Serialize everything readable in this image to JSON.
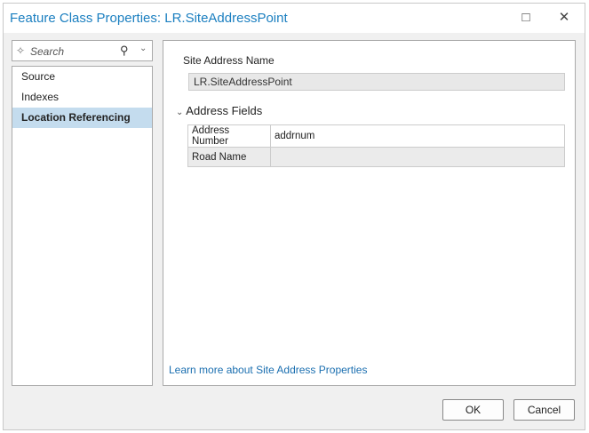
{
  "window": {
    "title": "Feature Class Properties: LR.SiteAddressPoint",
    "maximize_icon": "□",
    "close_icon": "✕"
  },
  "sidebar": {
    "search_placeholder": "Search",
    "items": [
      {
        "label": "Source"
      },
      {
        "label": "Indexes"
      },
      {
        "label": "Location Referencing",
        "selected": true
      }
    ]
  },
  "main": {
    "site_address_name_label": "Site Address Name",
    "site_address_name_value": "LR.SiteAddressPoint",
    "section_title": "Address Fields",
    "fields": [
      {
        "name": "Address Number",
        "value": "addrnum"
      },
      {
        "name": "Road Name",
        "value": ""
      }
    ],
    "learn_more_link": "Learn more about Site Address Properties"
  },
  "buttons": {
    "ok": "OK",
    "cancel": "Cancel"
  }
}
